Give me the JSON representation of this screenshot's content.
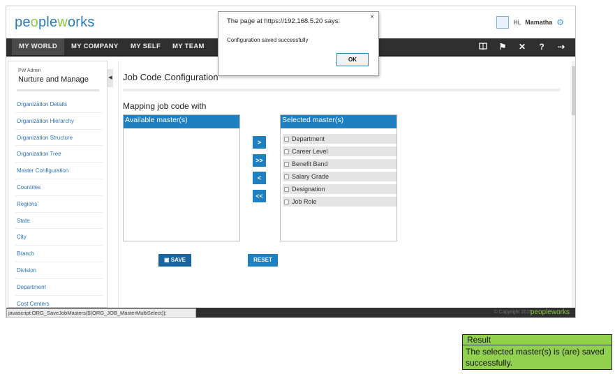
{
  "header": {
    "logo_a": "pe",
    "logo_b": "o",
    "logo_c": "ple",
    "logo_d": "w",
    "logo_e": "o",
    "logo_f": "rks",
    "greeting": "Hi,",
    "user_name": "Mamatha"
  },
  "nav": {
    "items": [
      "MY WORLD",
      "MY COMPANY",
      "MY SELF",
      "MY TEAM"
    ],
    "active": "MY WORLD",
    "icons": [
      "book-icon",
      "flag-icon",
      "tools-icon",
      "help-icon",
      "logout-icon"
    ]
  },
  "sidebar": {
    "subtitle": "PW Admin",
    "title": "Nurture and Manage",
    "items": [
      "Organization Details",
      "Organization Hierarchy",
      "Organization Structure",
      "Organization Tree",
      "Master Configuration",
      "Countries",
      "Regions",
      "State",
      "City",
      "Branch",
      "Division",
      "Department",
      "Cost Centers"
    ]
  },
  "main": {
    "page_title": "Job Code Configuration",
    "mapping_label": "Mapping job code with",
    "available_header": "Available master(s)",
    "selected_header": "Selected master(s)",
    "selected_items": [
      "Department",
      "Career Level",
      "Benefit Band",
      "Salary Grade",
      "Designation",
      "Job Role"
    ],
    "move_buttons": [
      ">",
      ">>",
      "<",
      "<<"
    ],
    "save_label": "SAVE",
    "reset_label": "RESET"
  },
  "footer": {
    "copyright": "© Copyright 2015",
    "logo": "peopleworks",
    "status_text": "javascript:ORG_SaveJobMasters($(ORG_JOB_MasterMultiSelect));"
  },
  "dialog": {
    "title": "The page at https://192.168.5.20 says:",
    "message": "Configuration saved successfully",
    "ok_label": "OK",
    "close": "×"
  },
  "result": {
    "header": "Result",
    "text": "The selected master(s) is (are) saved successfully."
  },
  "colors": {
    "brand_blue": "#2b7cb6",
    "brand_green": "#8dc63f",
    "accent_blue": "#1e80c1",
    "nav_dark": "#2f2f2f",
    "result_green": "#92d050"
  }
}
